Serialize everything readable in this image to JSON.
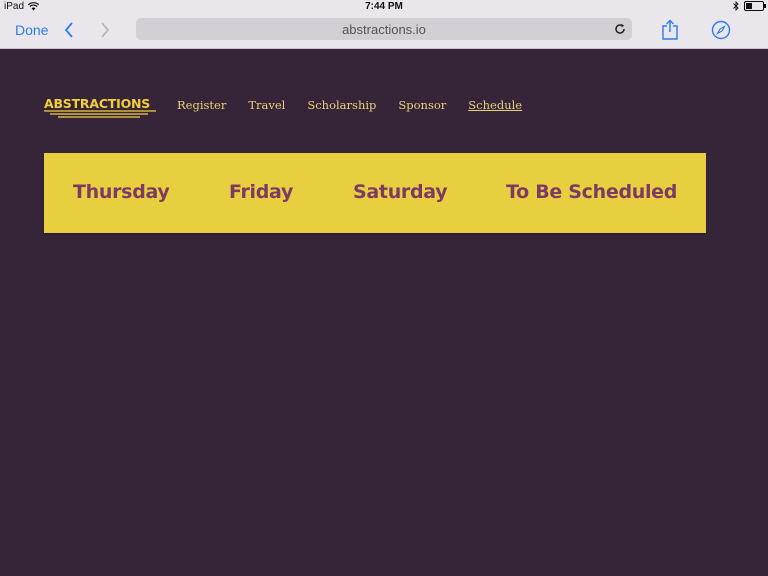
{
  "statusbar": {
    "device": "iPad",
    "time": "7:44 PM",
    "battery_level": 0.35
  },
  "browser": {
    "done_label": "Done",
    "url": "abstractions.io",
    "icons": [
      "back-chevron-icon",
      "forward-chevron-icon",
      "reload-icon",
      "share-icon",
      "compass-icon",
      "wifi-icon",
      "bluetooth-icon",
      "battery-icon"
    ]
  },
  "site": {
    "logo_text": "ABSTRACTIONS",
    "nav": [
      "Register",
      "Travel",
      "Scholarship",
      "Sponsor",
      "Schedule"
    ],
    "active_nav": "Schedule",
    "days": [
      "Thursday",
      "Friday",
      "Saturday",
      "To Be Scheduled"
    ],
    "colors": {
      "background": "#362538",
      "accent": "#e8cf3f",
      "day_text": "#7d3b63",
      "nav_text": "#e8d27a"
    }
  }
}
